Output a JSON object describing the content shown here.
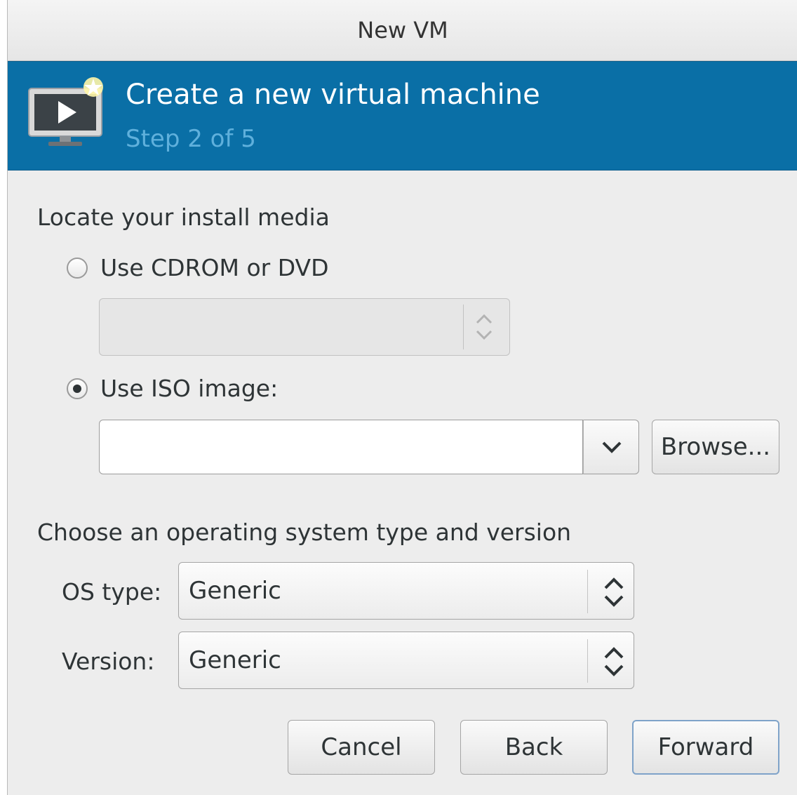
{
  "window": {
    "title": "New VM"
  },
  "banner": {
    "title": "Create a new virtual machine",
    "step": "Step 2 of 5",
    "icon": "vm-monitor-new-icon"
  },
  "install_media": {
    "heading": "Locate your install media",
    "cdrom_option": {
      "label": "Use CDROM or DVD",
      "selected": false,
      "device_value": ""
    },
    "iso_option": {
      "label": "Use ISO image:",
      "selected": true,
      "path_value": ""
    },
    "browse_label": "Browse..."
  },
  "os": {
    "heading": "Choose an operating system type and version",
    "type_label": "OS type:",
    "type_value": "Generic",
    "version_label": "Version:",
    "version_value": "Generic"
  },
  "buttons": {
    "cancel": "Cancel",
    "back": "Back",
    "forward": "Forward"
  },
  "colors": {
    "banner": "#0a6fa6",
    "banner_subtitle": "#5fb0dc",
    "background": "#ededed"
  }
}
